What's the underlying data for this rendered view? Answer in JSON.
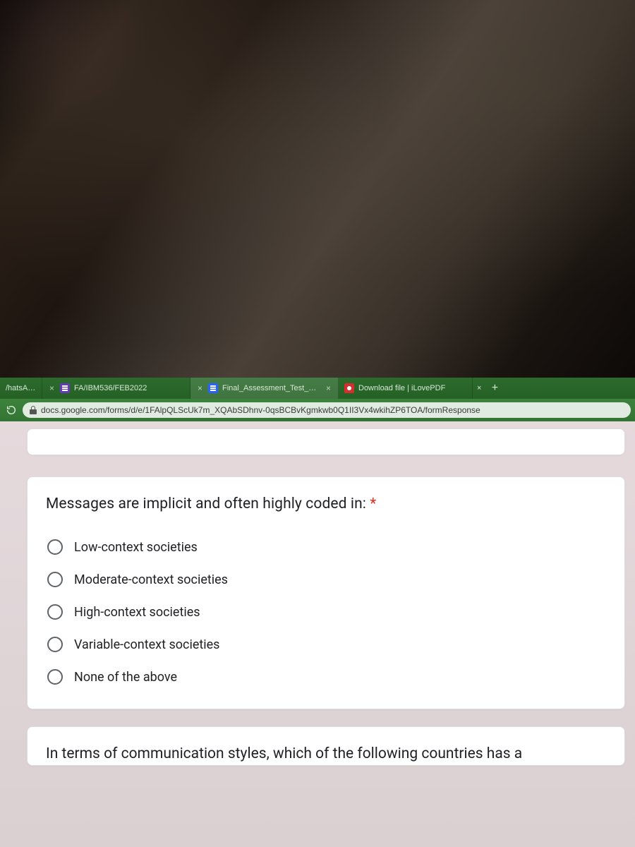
{
  "tabs": [
    {
      "title": "/hatsApp"
    },
    {
      "title": "FA/IBM536/FEB2022"
    },
    {
      "title": "Final_Assessment_Test_Declaratio"
    },
    {
      "title": "Download file | iLovePDF"
    }
  ],
  "new_tab_label": "+",
  "url": "docs.google.com/forms/d/e/1FAlpQLScUk7m_XQAbSDhnv-0qsBCBvKgmkwb0Q1II3Vx4wkihZP6TOA/formResponse",
  "question1": {
    "text": "Messages are implicit and often highly coded in:",
    "required": "*",
    "options": [
      "Low-context societies",
      "Moderate-context societies",
      "High-context societies",
      "Variable-context societies",
      "None of the above"
    ]
  },
  "question2": {
    "text": "In terms of communication styles, which of the following countries has a"
  }
}
